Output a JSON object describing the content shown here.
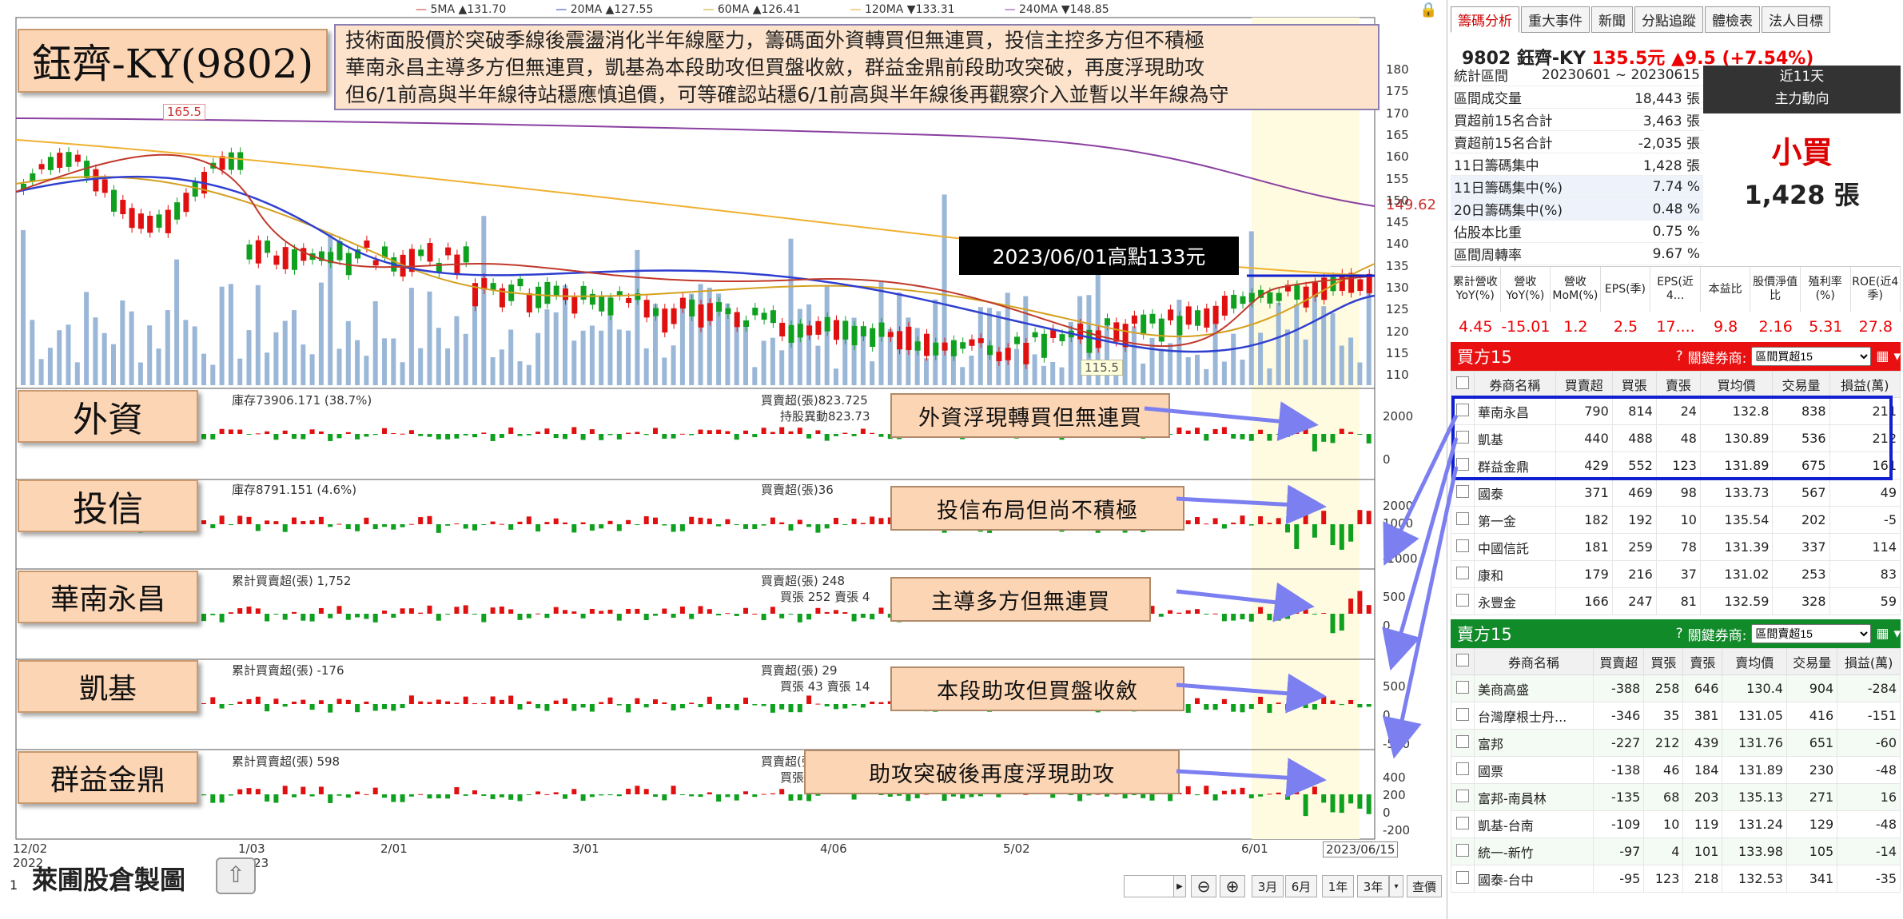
{
  "title": "鈺齊-KY(9802)",
  "summary_lines": [
    "技術面股價於突破季線後震盪消化半年線壓力，籌碼面外資轉買但無連買，投信主控多方但不積極",
    "華南永昌主導多方但無連買，凱基為本段助攻但買盤收斂，群益金鼎前段助攻突破，再度浮現助攻",
    "但6/1前高與半年線待站穩應慎追價，可等確認站穩6/1前高與半年線後再觀察介入並暫以半年線為守"
  ],
  "ma_legend": [
    {
      "label": "5MA ▲131.70",
      "color": "#c0392b"
    },
    {
      "label": "20MA ▲127.55",
      "color": "#2f3fd0"
    },
    {
      "label": "60MA ▲126.41",
      "color": "#d4a020"
    },
    {
      "label": "120MA ▼133.31",
      "color": "#f0a020"
    },
    {
      "label": "240MA ▼148.85",
      "color": "#8a3fa0"
    }
  ],
  "price_axis": [
    "180",
    "175",
    "170",
    "165",
    "160",
    "155",
    "150",
    "145",
    "140",
    "135",
    "130",
    "125",
    "120",
    "115",
    "110"
  ],
  "price_right_marker": "149.62",
  "high_marker": "165.5",
  "low_marker": "115.5",
  "callout_high": "2023/06/01高點133元",
  "panels": [
    {
      "tag": "外資",
      "info1": "庫存73906.171 (38.7%)",
      "info2": "買賣超(張)823.725",
      "info3": "持股異動823.73",
      "note": "外資浮現轉買但無連買",
      "axis": [
        "2000",
        "0"
      ]
    },
    {
      "tag": "投信",
      "info1": "庫存8791.151 (4.6%)",
      "info2": "買賣超(張)36",
      "info3": "",
      "note": "投信布局但尚不積極",
      "axis": [
        "2000",
        "1000",
        "0",
        "-1000"
      ]
    },
    {
      "tag": "華南永昌",
      "info1": "累計買賣超(張) 1,752",
      "info2": "買賣超(張) 248",
      "info3": "買張 252 賣張 4",
      "note": "主導多方但無連買",
      "axis": [
        "500",
        "0"
      ]
    },
    {
      "tag": "凱基",
      "info1": "累計買賣超(張) -176",
      "info2": "買賣超(張) 29",
      "info3": "買張 43 賣張 14",
      "note": "本段助攻但買盤收斂",
      "axis": [
        "500",
        "0",
        "-500"
      ]
    },
    {
      "tag": "群益金鼎",
      "info1": "累計買賣超(張) 598",
      "info2": "買賣超(張)",
      "info3": "買張",
      "note": "助攻突破後再度浮現助攻",
      "axis": [
        "400",
        "200",
        "0",
        "-200"
      ]
    }
  ],
  "x_labels": [
    "12/02",
    "2022",
    "1/03",
    "2023",
    "2/01",
    "3/01",
    "4/06",
    "5/02",
    "6/01",
    "2023/06/15"
  ],
  "credit": "萊圃股倉製圖",
  "toolbar": {
    "range_buttons": [
      "3月",
      "6月",
      "1年",
      "3年"
    ],
    "query": "查價",
    "page_no": "1"
  },
  "panel_right": {
    "tabs": [
      "籌碼分析",
      "重大事件",
      "新聞",
      "分點追蹤",
      "體檢表",
      "法人目標"
    ],
    "stock": "9802 鈺齊-KY",
    "price": "135.5元",
    "change": "▲9.5 (+7.54%)",
    "stats": [
      {
        "k": "統計區間",
        "v": "20230601 ~ 20230615"
      },
      {
        "k": "區間成交量",
        "v": "18,443 張"
      },
      {
        "k": "買超前15名合計",
        "v": "3,463 張"
      },
      {
        "k": "賣超前15名合計",
        "v": "-2,035 張"
      },
      {
        "k": "11日籌碼集中",
        "v": "1,428 張"
      },
      {
        "k": "11日籌碼集中(%)",
        "v": "7.74 %"
      },
      {
        "k": "20日籌碼集中(%)",
        "v": "0.48 %"
      },
      {
        "k": "佔股本比重",
        "v": "0.75 %"
      },
      {
        "k": "區間周轉率",
        "v": "9.67 %"
      }
    ],
    "trend_title": "近11天",
    "trend_sub": "主力動向",
    "trend_label": "小買",
    "trend_value": "1,428 張",
    "kpi_headers": [
      "累計營收YoY(%)",
      "營收YoY(%)",
      "營收MoM(%)",
      "EPS(季)",
      "EPS(近4...",
      "本益比",
      "股價淨值比",
      "殖利率(%)",
      "ROE(近4季)"
    ],
    "kpi_values": [
      "4.45",
      "-15.01",
      "1.2",
      "2.5",
      "17....",
      "9.8",
      "2.16",
      "5.31",
      "27.8"
    ],
    "buy_title": "買方15",
    "sell_title": "賣方15",
    "key_broker_label": "關鍵券商:",
    "buy_select": "區間買超15",
    "sell_select": "區間賣超15",
    "buy_cols": [
      "券商名稱",
      "買賣超",
      "買張",
      "賣張",
      "買均價",
      "交易量",
      "損益(萬)"
    ],
    "sell_cols": [
      "券商名稱",
      "買賣超",
      "買張",
      "賣張",
      "賣均價",
      "交易量",
      "損益(萬)"
    ],
    "buy_rows": [
      [
        "華南永昌",
        "790",
        "814",
        "24",
        "132.8",
        "838",
        "211"
      ],
      [
        "凱基",
        "440",
        "488",
        "48",
        "130.89",
        "536",
        "212"
      ],
      [
        "群益金鼎",
        "429",
        "552",
        "123",
        "131.89",
        "675",
        "161"
      ],
      [
        "國泰",
        "371",
        "469",
        "98",
        "133.73",
        "567",
        "49"
      ],
      [
        "第一金",
        "182",
        "192",
        "10",
        "135.54",
        "202",
        "-5"
      ],
      [
        "中國信託",
        "181",
        "259",
        "78",
        "131.39",
        "337",
        "114"
      ],
      [
        "康和",
        "179",
        "216",
        "37",
        "131.02",
        "253",
        "83"
      ],
      [
        "永豐金",
        "166",
        "247",
        "81",
        "132.59",
        "328",
        "59"
      ]
    ],
    "sell_rows": [
      [
        "美商高盛",
        "-388",
        "258",
        "646",
        "130.4",
        "904",
        "-284"
      ],
      [
        "台灣摩根士丹...",
        "-346",
        "35",
        "381",
        "131.05",
        "416",
        "-151"
      ],
      [
        "富邦",
        "-227",
        "212",
        "439",
        "131.76",
        "651",
        "-60"
      ],
      [
        "國票",
        "-138",
        "46",
        "184",
        "131.89",
        "230",
        "-48"
      ],
      [
        "富邦-南員林",
        "-135",
        "68",
        "203",
        "135.13",
        "271",
        "16"
      ],
      [
        "凱基-台南",
        "-109",
        "10",
        "119",
        "131.24",
        "129",
        "-48"
      ],
      [
        "統一-新竹",
        "-97",
        "4",
        "101",
        "133.98",
        "105",
        "-14"
      ],
      [
        "國泰-台中",
        "-95",
        "123",
        "218",
        "132.53",
        "341",
        "-35"
      ]
    ]
  }
}
